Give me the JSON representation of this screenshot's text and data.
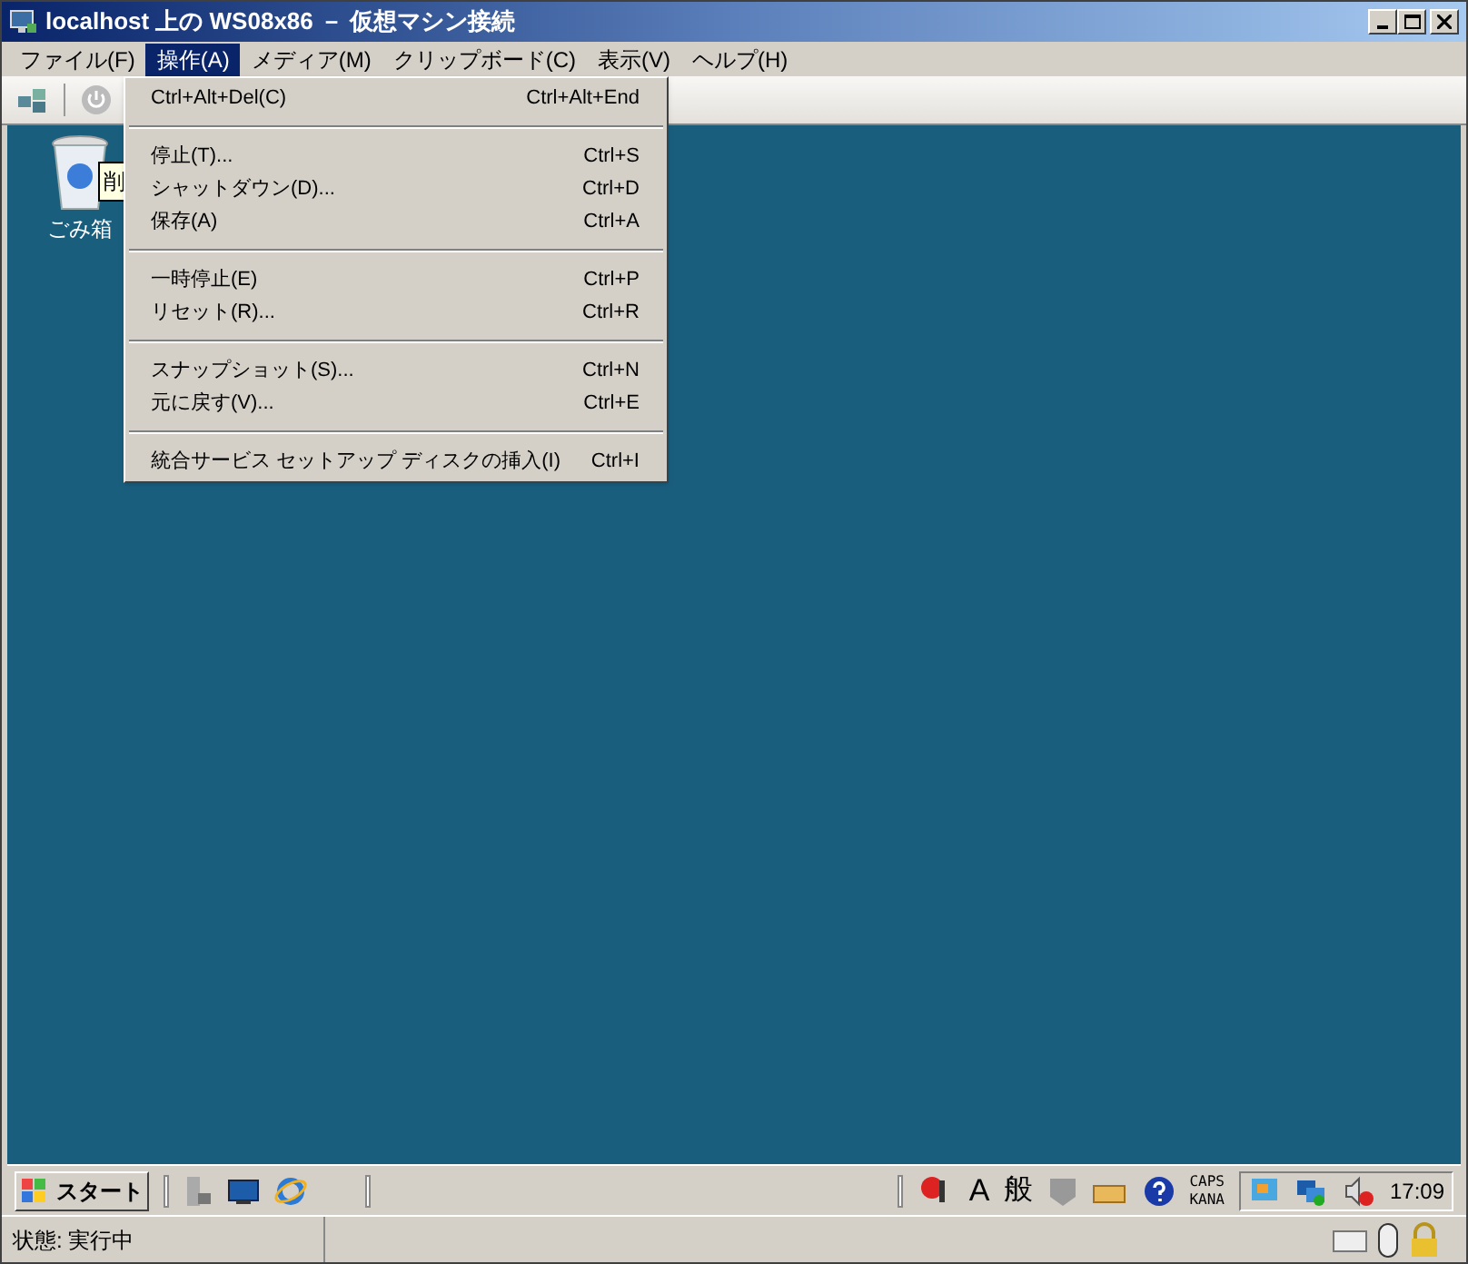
{
  "window": {
    "title": "localhost 上の WS08x86 － 仮想マシン接続"
  },
  "menu_bar": [
    {
      "label": "ファイル(F)",
      "selected": false
    },
    {
      "label": "操作(A)",
      "selected": true
    },
    {
      "label": "メディア(M)",
      "selected": false
    },
    {
      "label": "クリップボード(C)",
      "selected": false
    },
    {
      "label": "表示(V)",
      "selected": false
    },
    {
      "label": "ヘルプ(H)",
      "selected": false
    }
  ],
  "menu": [
    {
      "kind": "item",
      "label": "Ctrl+Alt+Del(C)",
      "shortcut": "Ctrl+Alt+End"
    },
    {
      "kind": "separator"
    },
    {
      "kind": "item",
      "label": "停止(T)...",
      "shortcut": "Ctrl+S"
    },
    {
      "kind": "item",
      "label": "シャットダウン(D)...",
      "shortcut": "Ctrl+D"
    },
    {
      "kind": "item",
      "label": "保存(A)",
      "shortcut": "Ctrl+A"
    },
    {
      "kind": "separator"
    },
    {
      "kind": "item",
      "label": "一時停止(E)",
      "shortcut": "Ctrl+P"
    },
    {
      "kind": "item",
      "label": "リセット(R)...",
      "shortcut": "Ctrl+R"
    },
    {
      "kind": "separator"
    },
    {
      "kind": "item",
      "label": "スナップショット(S)...",
      "shortcut": "Ctrl+N"
    },
    {
      "kind": "item",
      "label": "元に戻す(V)...",
      "shortcut": "Ctrl+E"
    },
    {
      "kind": "separator"
    },
    {
      "kind": "item",
      "label": "統合サービス セットアップ ディスクの挿入(I)",
      "shortcut": "Ctrl+I"
    }
  ],
  "desktop": {
    "icon_label": "ごみ箱",
    "tooltip": "削"
  },
  "taskbar": {
    "start": "スタート",
    "ime_mode": "A",
    "ime_kanji": "般",
    "caps": "CAPS",
    "kana": "KANA",
    "clock": "17:09"
  },
  "status_bar": {
    "text": "状態: 実行中"
  }
}
